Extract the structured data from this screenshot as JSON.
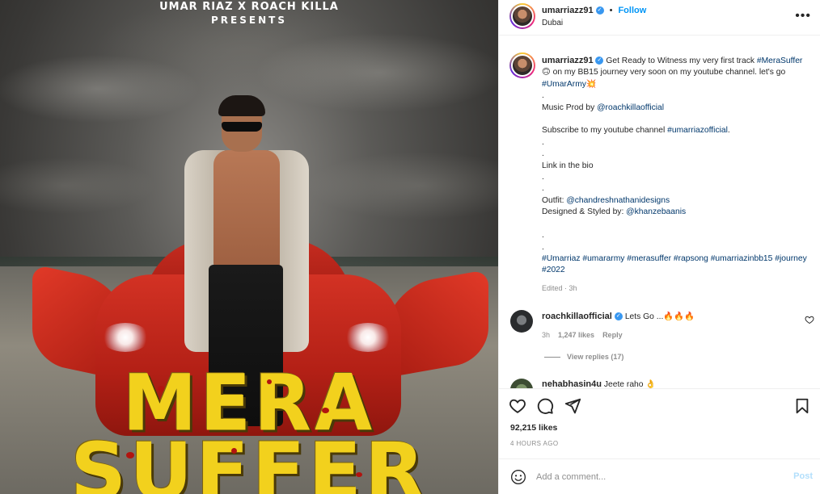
{
  "poster": {
    "credit_line": "UMAR RIAZ X ROACH KILLA",
    "presents": "PRESENTS",
    "title_line1": "MERA",
    "title_line2": "SUFFER"
  },
  "post": {
    "username": "umarriazz91",
    "separator": "•",
    "follow_label": "Follow",
    "location": "Dubai",
    "more_icon": "more-options-icon",
    "caption": {
      "p1": "Get Ready to Witness my very first track ",
      "tag1": "#MeraSuffer",
      "p2": " 🙃 on my BB15 journey very soon on my youtube channel. let's go ",
      "tag2": "#UmarArmy",
      "p3": "💥\n.\nMusic Prod by ",
      "mention1": "@roachkillaofficial",
      "p4": "\n\nSubscribe to my youtube channel ",
      "tag3": "#umarriazofficial",
      "p5": ".\n.\n.\nLink in the bio\n.\n.\nOutfit: ",
      "mention2": "@chandreshnathanidesigns",
      "p6": "\nDesigned & Styled by: ",
      "mention3": "@khanzebaanis",
      "p7": "\n\n.\n.\n",
      "tags_final": "#Umarriaz #umararmy #merasuffer #rapsong #umarriazinbb15 #journey #2022"
    },
    "edited": "Edited · 3h"
  },
  "comments": [
    {
      "username": "roachkillaofficial",
      "text": "Lets Go ...🔥🔥🔥",
      "time": "3h",
      "likes": "1,247 likes",
      "reply": "Reply",
      "view_replies": "View replies (17)"
    },
    {
      "username": "nehabhasin4u",
      "text": "Jeete raho 👌"
    }
  ],
  "footer": {
    "likes": "92,215 likes",
    "time_ago": "4 HOURS AGO",
    "comment_placeholder": "Add a comment...",
    "post_label": "Post"
  },
  "colors": {
    "follow": "#0095f6",
    "verified": "#3897f0",
    "title_yellow": "#f2d11d",
    "post_disabled": "#b2dffc"
  }
}
